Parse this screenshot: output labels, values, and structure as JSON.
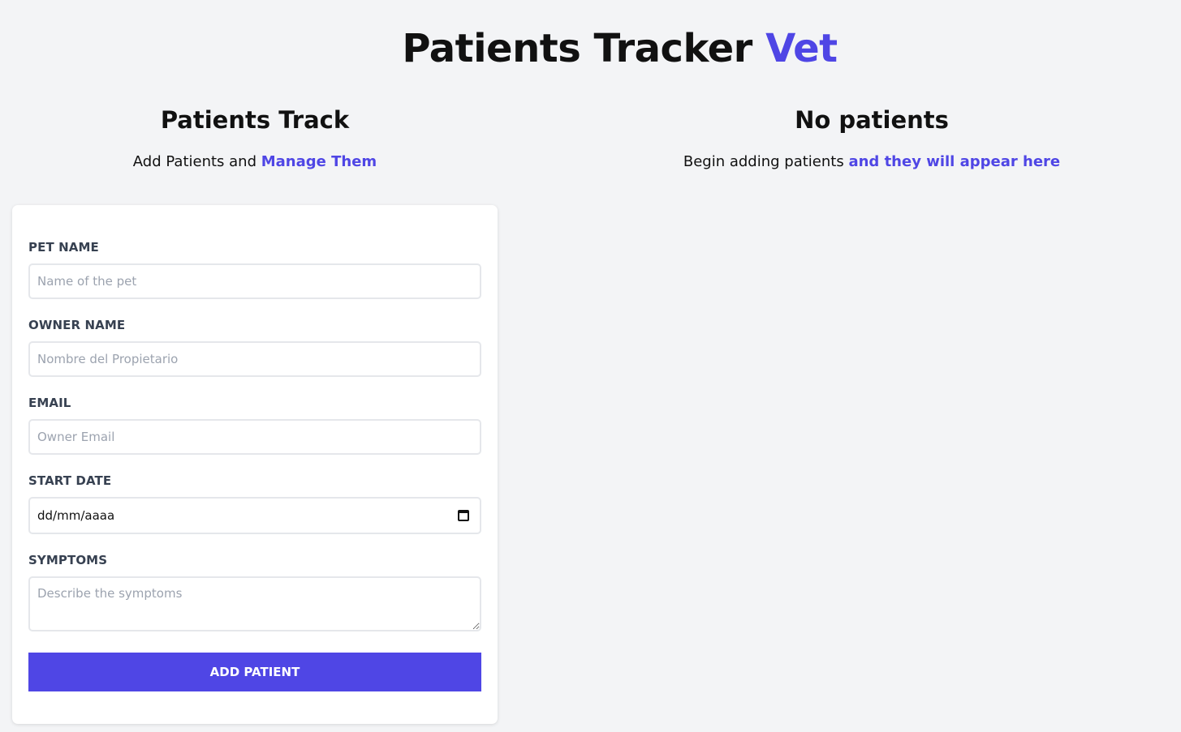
{
  "header": {
    "title_main": "Patients Tracker",
    "title_accent": "Vet"
  },
  "form_section": {
    "title": "Patients Track",
    "subtitle_plain": "Add Patients and",
    "subtitle_accent": "Manage Them"
  },
  "list_section": {
    "title": "No patients",
    "subtitle_plain": "Begin adding patients",
    "subtitle_accent": "and they will appear here"
  },
  "form": {
    "pet_name": {
      "label": "Pet Name",
      "placeholder": "Name of the pet",
      "value": ""
    },
    "owner_name": {
      "label": "Owner Name",
      "placeholder": "Nombre del Propietario",
      "value": ""
    },
    "email": {
      "label": "Email",
      "placeholder": "Owner Email",
      "value": ""
    },
    "start_date": {
      "label": "Start Date",
      "display": "dd/mm/aaaa"
    },
    "symptoms": {
      "label": "Symptoms",
      "placeholder": "Describe the symptoms",
      "value": ""
    },
    "submit_label": "Add Patient"
  },
  "colors": {
    "accent": "#4f46e5",
    "background": "#f3f4f6",
    "card": "#ffffff"
  },
  "icons": {
    "date_picker": "calendar-icon"
  }
}
